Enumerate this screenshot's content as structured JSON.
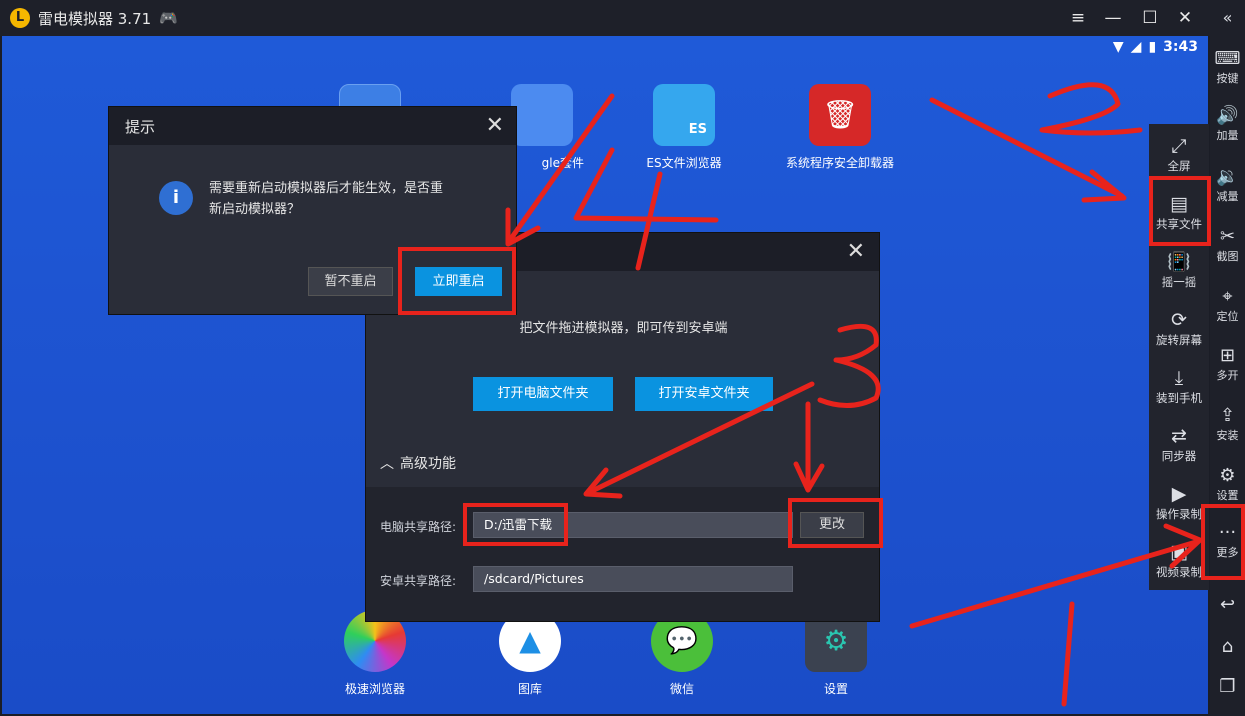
{
  "window": {
    "title": "雷电模拟器 3.71",
    "logo_letter": "L"
  },
  "titlebar_icons": [
    "menu-icon",
    "minimize-icon",
    "maximize-icon",
    "close-icon",
    "collapse-icon"
  ],
  "status": {
    "time": "3:43"
  },
  "apps_top": [
    {
      "label": "",
      "icon": "tools-folder-icon"
    },
    {
      "label": "gle套件",
      "icon": "google-suite-icon"
    },
    {
      "label": "ES文件浏览器",
      "icon": "es-file-explorer-icon",
      "badge": "ES"
    },
    {
      "label": "系统程序安全卸载器",
      "icon": "uninstaller-icon"
    }
  ],
  "apps_bottom": [
    {
      "label": "极速浏览器",
      "icon": "browser-icon"
    },
    {
      "label": "图库",
      "icon": "gallery-icon"
    },
    {
      "label": "微信",
      "icon": "wechat-icon"
    },
    {
      "label": "设置",
      "icon": "settings-app-icon"
    }
  ],
  "sidebar": [
    {
      "label": "按键",
      "icon": "keyboard-icon",
      "glyph": "⌨"
    },
    {
      "label": "加量",
      "icon": "volume-up-icon",
      "glyph": "🔊"
    },
    {
      "label": "减量",
      "icon": "volume-down-icon",
      "glyph": "🔉"
    },
    {
      "label": "截图",
      "icon": "scissors-icon",
      "glyph": "✂"
    },
    {
      "label": "定位",
      "icon": "location-icon",
      "glyph": "⌖"
    },
    {
      "label": "多开",
      "icon": "multi-open-icon",
      "glyph": "⊞"
    },
    {
      "label": "安装",
      "icon": "apk-install-icon",
      "glyph": "⇪"
    },
    {
      "label": "设置",
      "icon": "gear-icon",
      "glyph": "⚙"
    },
    {
      "label": "更多",
      "icon": "more-icon",
      "glyph": "···"
    }
  ],
  "sidebar_nav": [
    {
      "icon": "back-icon",
      "glyph": "↩"
    },
    {
      "icon": "home-icon",
      "glyph": "⌂"
    },
    {
      "icon": "recent-apps-icon",
      "glyph": "❐"
    }
  ],
  "more_panel": [
    {
      "label": "全屏",
      "icon": "fullscreen-icon",
      "glyph": "⤢"
    },
    {
      "label": "共享文件",
      "icon": "share-file-icon",
      "glyph": "▤"
    },
    {
      "label": "摇一摇",
      "icon": "shake-icon",
      "glyph": "📳"
    },
    {
      "label": "旋转屏幕",
      "icon": "rotate-icon",
      "glyph": "⟳"
    },
    {
      "label": "装到手机",
      "icon": "install-to-phone-icon",
      "glyph": "⤓"
    },
    {
      "label": "同步器",
      "icon": "sync-icon",
      "glyph": "⇄"
    },
    {
      "label": "操作录制",
      "icon": "record-action-icon",
      "glyph": "▶"
    },
    {
      "label": "视频录制",
      "icon": "video-record-icon",
      "glyph": "▣"
    }
  ],
  "share_dialog": {
    "hint": "把文件拖进模拟器，即可传到安卓端",
    "open_pc_folder": "打开电脑文件夹",
    "open_android_folder": "打开安卓文件夹",
    "advanced": "高级功能",
    "pc_path_label": "电脑共享路径:",
    "pc_path_value": "D:/迅雷下载",
    "change_button": "更改",
    "android_path_label": "安卓共享路径:",
    "android_path_value": "/sdcard/Pictures"
  },
  "prompt_dialog": {
    "title": "提示",
    "message_line1": "需要重新启动模拟器后才能生效，是否重",
    "message_line2": "新启动模拟器？",
    "later_button": "暂不重启",
    "restart_button": "立即重启"
  },
  "colors": {
    "accent": "#0a93e0",
    "annotation": "#e8231c",
    "desktop": "#1f5ad8"
  }
}
